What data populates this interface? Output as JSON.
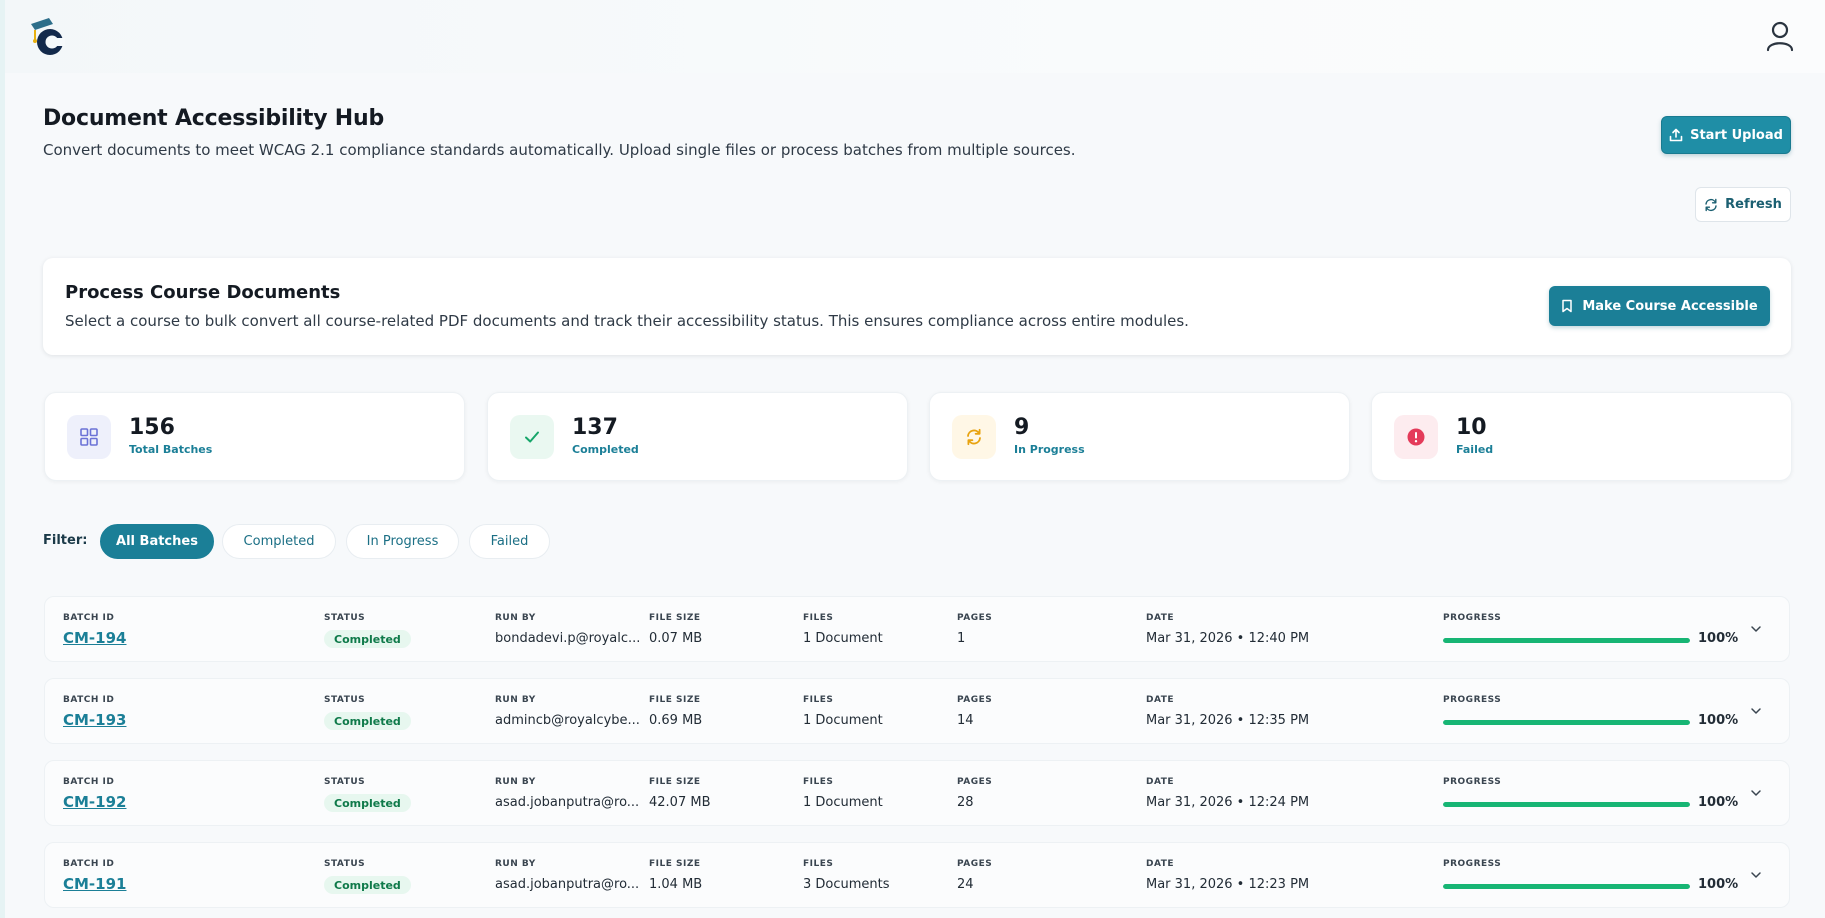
{
  "header": {
    "logo_letter": "C",
    "logo_icon": "graduation-cap-logo",
    "user_icon": "user-profile-icon"
  },
  "page": {
    "title": "Document Accessibility Hub",
    "subtitle": "Convert documents to meet WCAG 2.1 compliance standards automatically. Upload single files or process batches from multiple sources.",
    "upload_label": "Start Upload",
    "refresh_label": "Refresh"
  },
  "course": {
    "title": "Process Course Documents",
    "description": "Select a course to bulk convert all course-related PDF documents and track their accessibility status. This ensures compliance across entire modules.",
    "button_label": "Make Course Accessible"
  },
  "stats": [
    {
      "value": "156",
      "label": "Total Batches",
      "icon": "grid-icon",
      "color": "#6b72d6",
      "bg": "#eef0fb"
    },
    {
      "value": "137",
      "label": "Completed",
      "icon": "check-icon",
      "color": "#17a66a",
      "bg": "#eaf8f1"
    },
    {
      "value": "9",
      "label": "In Progress",
      "icon": "sync-icon",
      "color": "#e8a310",
      "bg": "#fff7e6"
    },
    {
      "value": "10",
      "label": "Failed",
      "icon": "alert-icon",
      "color": "#e43b5a",
      "bg": "#fdecef"
    }
  ],
  "filter": {
    "label": "Filter:",
    "options": [
      "All Batches",
      "Completed",
      "In Progress",
      "Failed"
    ],
    "selected": "All Batches"
  },
  "columns": {
    "batch_id": "BATCH ID",
    "status": "STATUS",
    "run_by": "RUN BY",
    "file_size": "FILE SIZE",
    "files": "FILES",
    "pages": "PAGES",
    "date": "DATE",
    "progress": "PROGRESS"
  },
  "batches": [
    {
      "id": "CM-194",
      "status": "Completed",
      "run_by": "bondadevi.p@royalc...",
      "file_size": "0.07 MB",
      "files": "1 Document",
      "pages": "1",
      "date": "Mar 31, 2026 • 12:40 PM",
      "progress": 1.0,
      "progress_label": "100%"
    },
    {
      "id": "CM-193",
      "status": "Completed",
      "run_by": "admincb@royalcybe...",
      "file_size": "0.69 MB",
      "files": "1 Document",
      "pages": "14",
      "date": "Mar 31, 2026 • 12:35 PM",
      "progress": 1.0,
      "progress_label": "100%"
    },
    {
      "id": "CM-192",
      "status": "Completed",
      "run_by": "asad.jobanputra@ro...",
      "file_size": "42.07 MB",
      "files": "1 Document",
      "pages": "28",
      "date": "Mar 31, 2026 • 12:24 PM",
      "progress": 1.0,
      "progress_label": "100%"
    },
    {
      "id": "CM-191",
      "status": "Completed",
      "run_by": "asad.jobanputra@ro...",
      "file_size": "1.04 MB",
      "files": "3 Documents",
      "pages": "24",
      "date": "Mar 31, 2026 • 12:23 PM",
      "progress": 1.0,
      "progress_label": "100%"
    }
  ]
}
